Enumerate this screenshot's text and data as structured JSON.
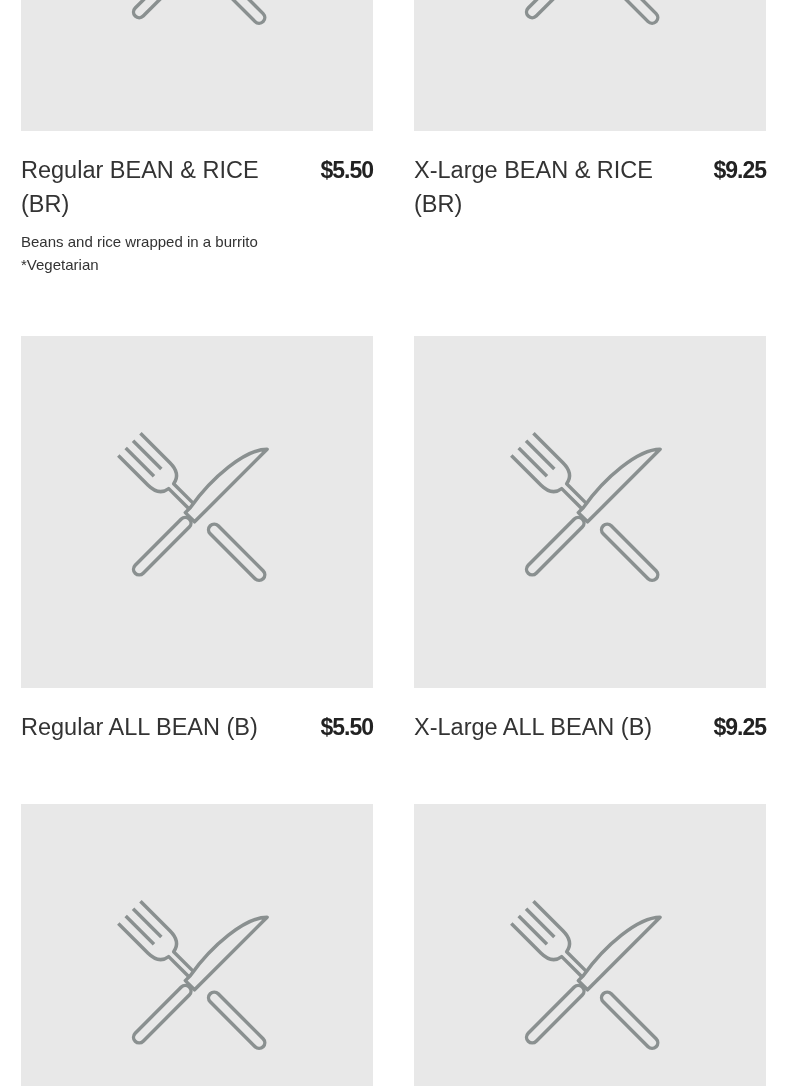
{
  "items": [
    {
      "kind": "product",
      "name": "Regular BEAN & RICE (BR)",
      "price": "$5.50",
      "description": "Beans and rice wrapped in a burrito\n*Vegetarian"
    },
    {
      "kind": "product",
      "name": "X-Large BEAN & RICE (BR)",
      "price": "$9.25"
    },
    {
      "kind": "product",
      "name": "Regular ALL BEAN (B)",
      "price": "$5.50"
    },
    {
      "kind": "product",
      "name": "X-Large ALL BEAN (B)",
      "price": "$9.25"
    },
    {
      "kind": "image-only"
    },
    {
      "kind": "image-only"
    }
  ]
}
